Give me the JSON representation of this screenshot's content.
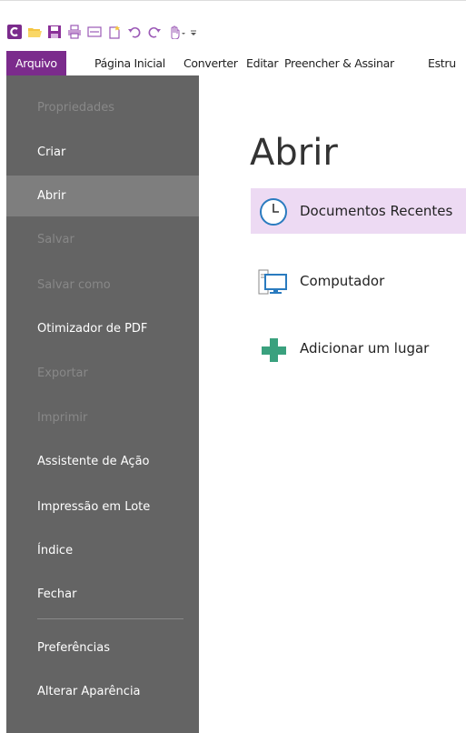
{
  "quick_access": {
    "icons": [
      "app-logo-icon",
      "open-folder-icon",
      "save-icon",
      "print-icon",
      "scan-icon",
      "new-doc-icon",
      "undo-icon",
      "redo-icon",
      "hand-tool-icon",
      "customize-dropdown-icon"
    ]
  },
  "ribbon": {
    "tabs": [
      {
        "label": "Arquivo"
      },
      {
        "label": "Página Inicial"
      },
      {
        "label": "Converter"
      },
      {
        "label": "Editar"
      },
      {
        "label": "Preencher & Assinar"
      },
      {
        "label": "Estru"
      }
    ],
    "active_color": "#7b2b8c"
  },
  "sidebar": {
    "items": [
      {
        "label": "Propriedades",
        "enabled": false
      },
      {
        "label": "Criar",
        "enabled": true
      },
      {
        "label": "Abrir",
        "enabled": true,
        "selected": true
      },
      {
        "label": "Salvar",
        "enabled": false
      },
      {
        "label": "Salvar como",
        "enabled": false
      },
      {
        "label": "Otimizador de PDF",
        "enabled": true
      },
      {
        "label": "Exportar",
        "enabled": false
      },
      {
        "label": "Imprimir",
        "enabled": false
      },
      {
        "label": "Assistente de Ação",
        "enabled": true
      },
      {
        "label": "Impressão em Lote",
        "enabled": true
      },
      {
        "label": "Índice",
        "enabled": true
      },
      {
        "label": "Fechar",
        "enabled": true
      },
      {
        "label": "Preferências",
        "enabled": true
      },
      {
        "label": "Alterar Aparência",
        "enabled": true
      }
    ]
  },
  "main": {
    "title": "Abrir",
    "options": [
      {
        "label": "Documentos Recentes",
        "icon": "clock-icon",
        "selected": true
      },
      {
        "label": "Computador",
        "icon": "computer-icon",
        "selected": false
      },
      {
        "label": "Adicionar um lugar",
        "icon": "plus-icon",
        "selected": false
      }
    ],
    "selected_color": "#eddaf3"
  }
}
